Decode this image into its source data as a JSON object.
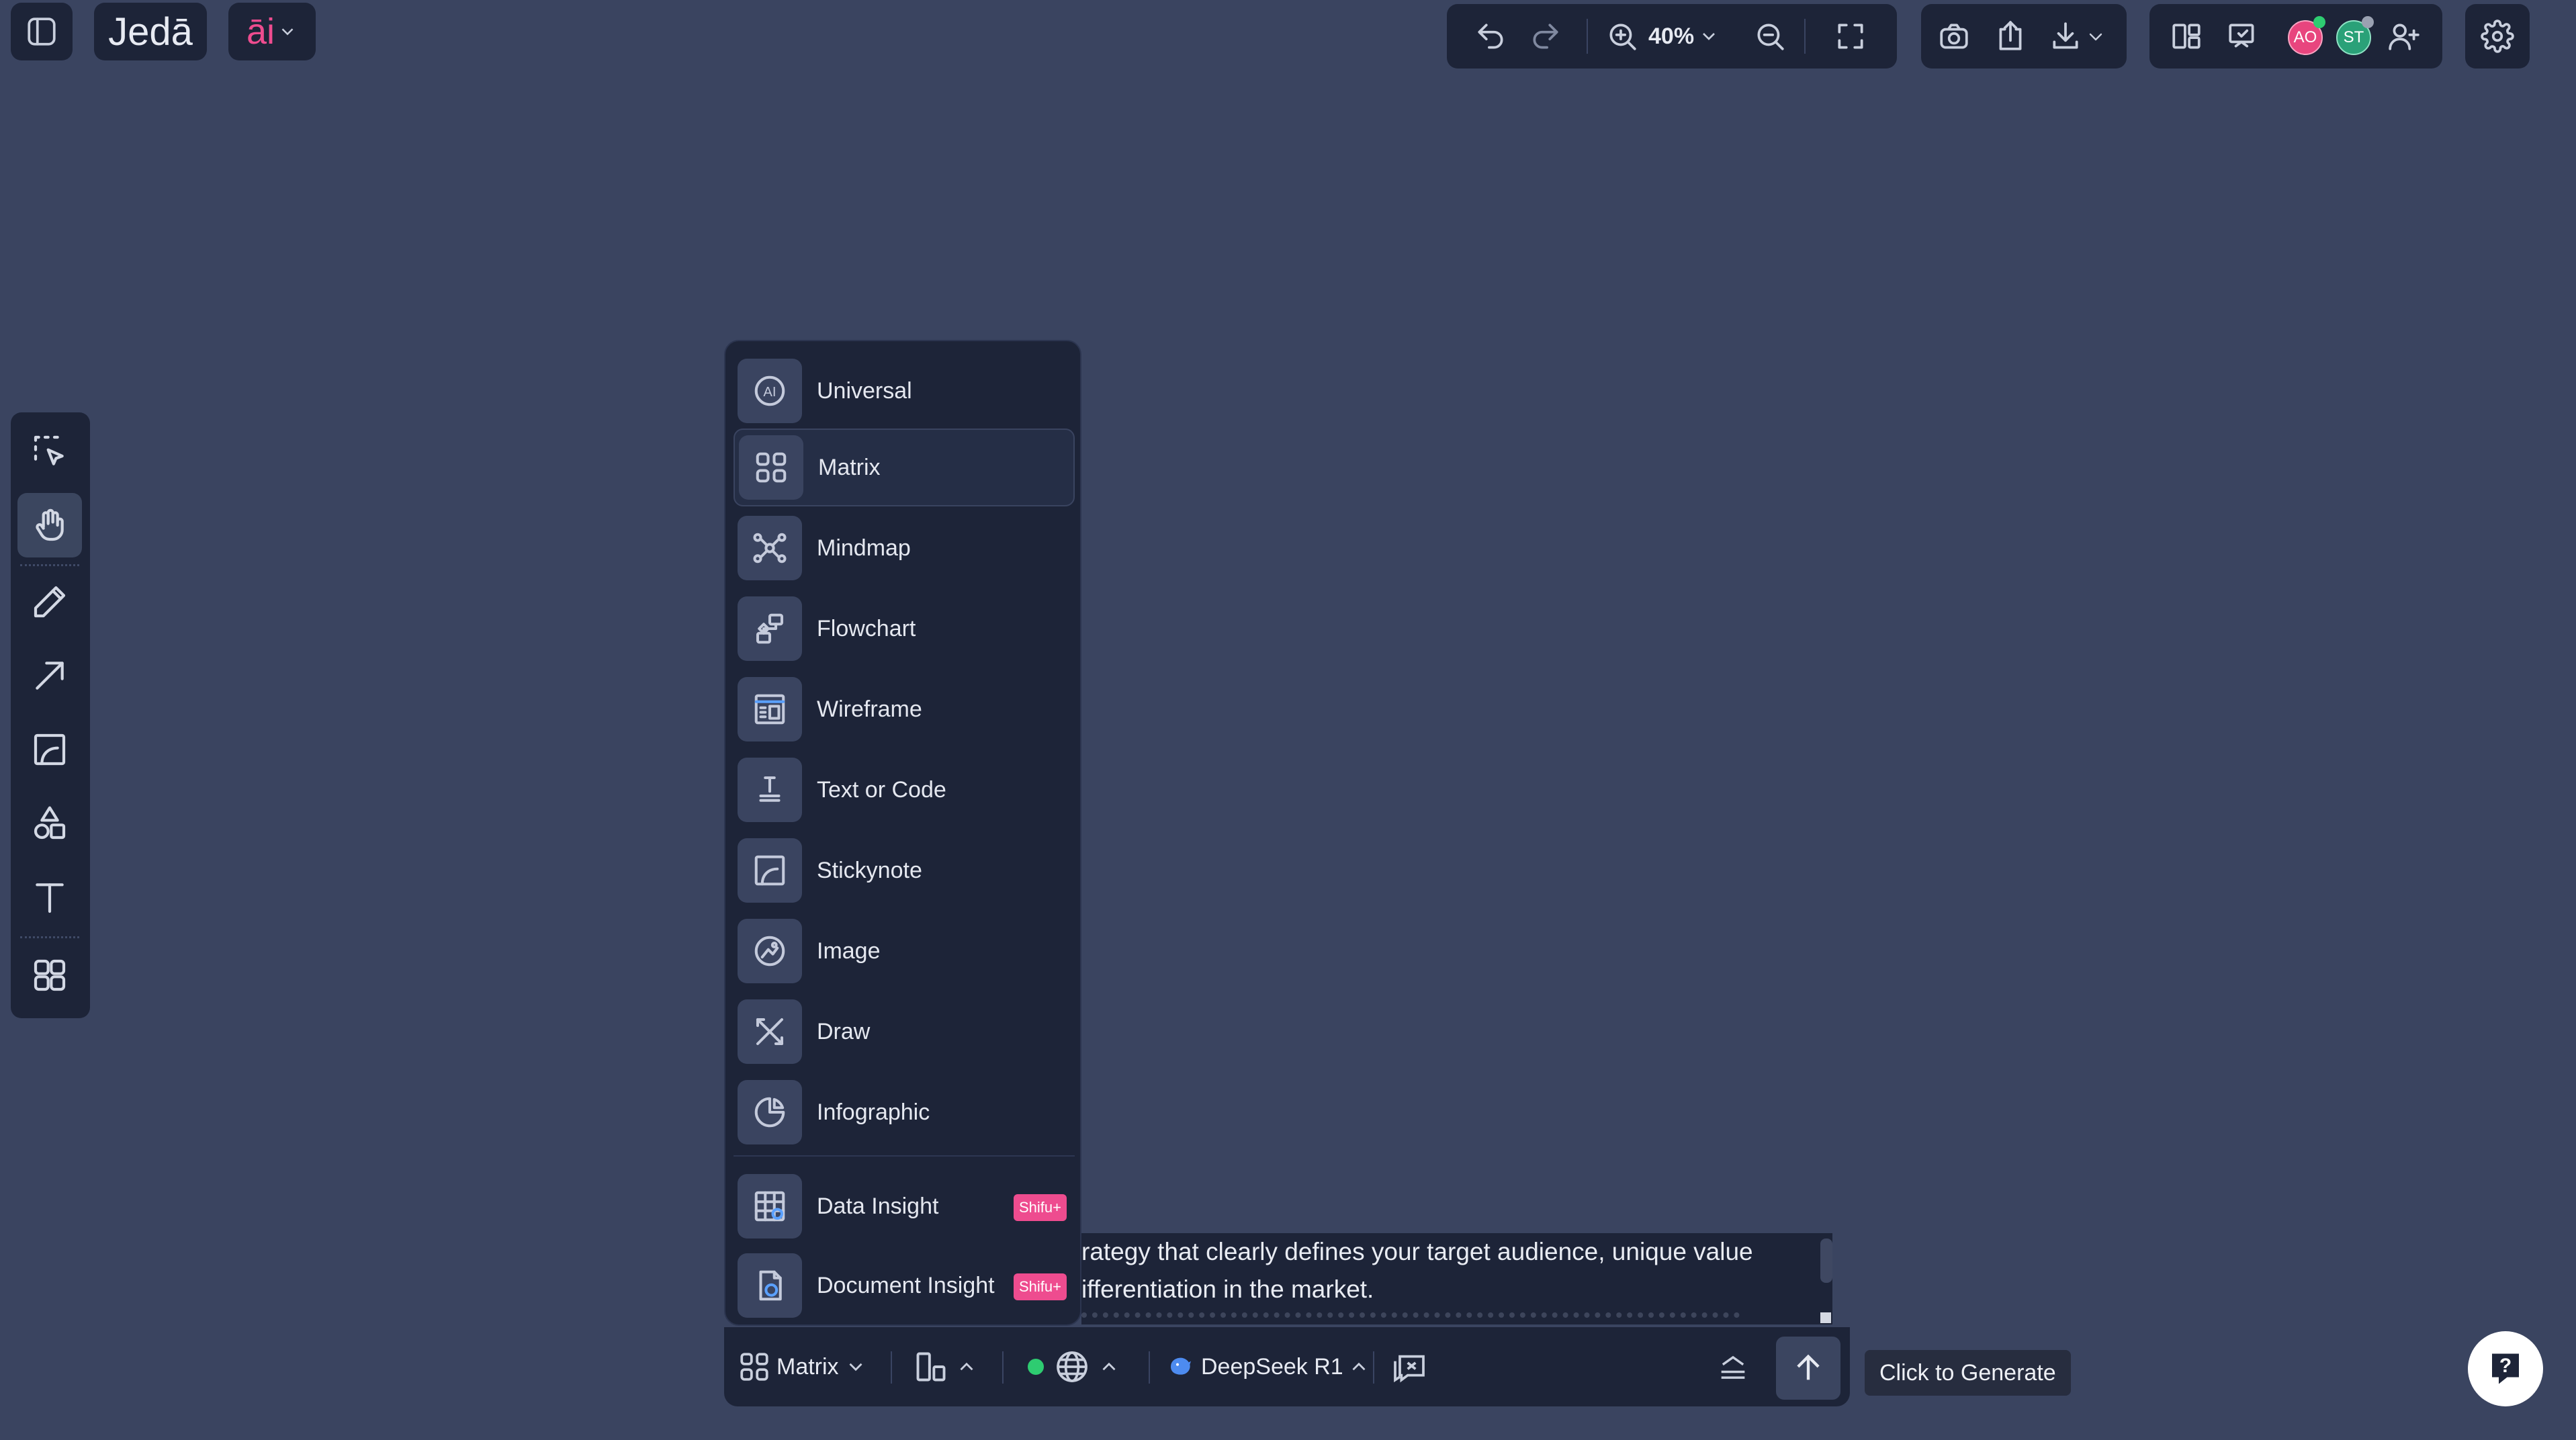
{
  "app": {
    "logo_text": "Jedā",
    "ai_label": "āi"
  },
  "toolbar": {
    "zoom": "40%"
  },
  "avatars": [
    {
      "initials": "AO",
      "color": "#e8457e"
    },
    {
      "initials": "ST",
      "color": "#2aa178"
    }
  ],
  "menu": {
    "items": [
      {
        "label": "Universal",
        "icon": "ai-circle-icon"
      },
      {
        "label": "Matrix",
        "icon": "matrix-grid-icon",
        "selected": true
      },
      {
        "label": "Mindmap",
        "icon": "mindmap-icon"
      },
      {
        "label": "Flowchart",
        "icon": "flowchart-icon"
      },
      {
        "label": "Wireframe",
        "icon": "wireframe-icon"
      },
      {
        "label": "Text or Code",
        "icon": "text-code-icon"
      },
      {
        "label": "Stickynote",
        "icon": "stickynote-icon"
      },
      {
        "label": "Image",
        "icon": "image-icon"
      },
      {
        "label": "Draw",
        "icon": "draw-icon"
      },
      {
        "label": "Infographic",
        "icon": "infographic-icon"
      },
      {
        "label": "Data Insight",
        "icon": "data-insight-icon",
        "badge": "Shifu+"
      },
      {
        "label": "Document Insight",
        "icon": "document-insight-icon",
        "badge": "Shifu+"
      }
    ]
  },
  "prompt": {
    "line1": "rategy that clearly defines your target audience, unique value",
    "line2": "ifferentiation in the market."
  },
  "bottom_bar": {
    "mode_label": "Matrix",
    "model_label": "DeepSeek R1",
    "status_color": "#2ecc71"
  },
  "tooltip": {
    "text": "Click to Generate"
  },
  "colors": {
    "canvas": "#3a4460",
    "panel": "#1d2438",
    "accent_pink": "#ee4c8f"
  }
}
